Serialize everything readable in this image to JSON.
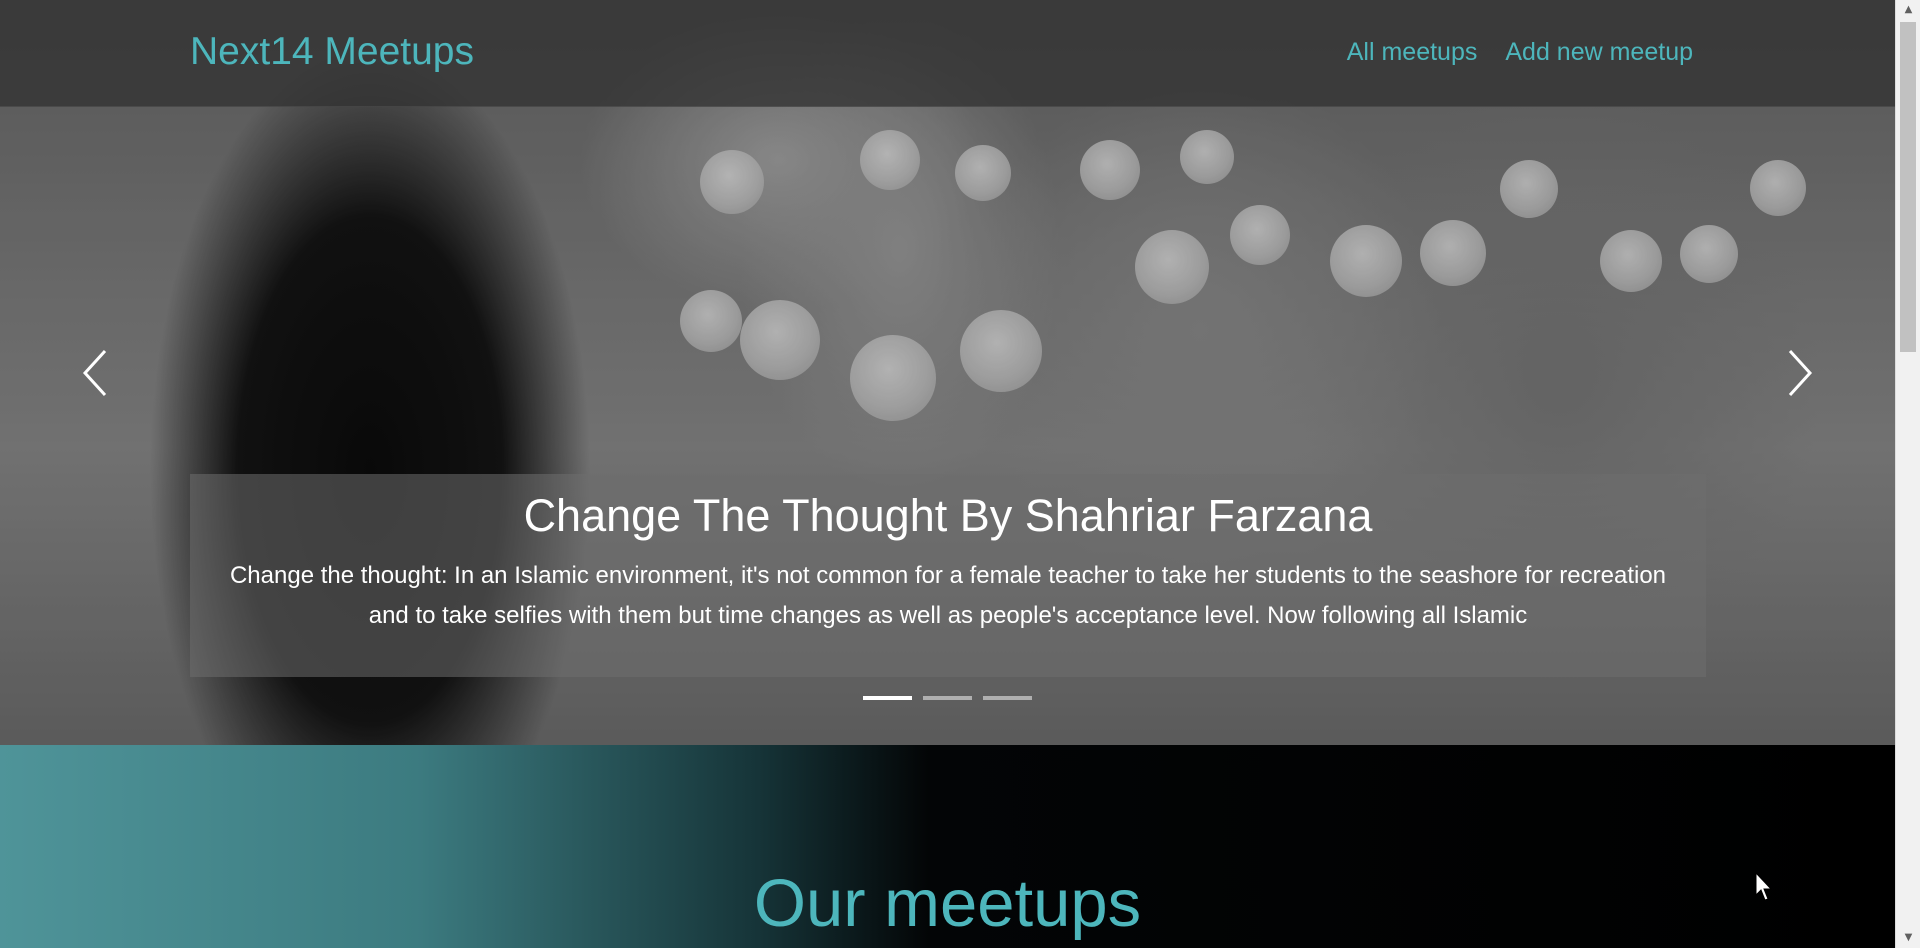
{
  "header": {
    "brand": "Next14 Meetups",
    "nav": [
      {
        "label": "All meetups"
      },
      {
        "label": "Add new meetup"
      }
    ]
  },
  "carousel": {
    "slide_title": "Change The Thought By Shahriar Farzana",
    "slide_text": "Change the thought: In an Islamic environment, it's not common for a female teacher to take her students to the seashore for recreation and to take selfies with them but time changes as well as people's acceptance level. Now following all Islamic",
    "slide_count": 3,
    "active_index": 0,
    "prev_icon": "chevron-left-icon",
    "next_icon": "chevron-right-icon"
  },
  "section": {
    "heading": "Our meetups"
  },
  "colors": {
    "accent": "#4db6bc",
    "header_bg": "#323232",
    "caption_bg": "#6e6e6e"
  }
}
